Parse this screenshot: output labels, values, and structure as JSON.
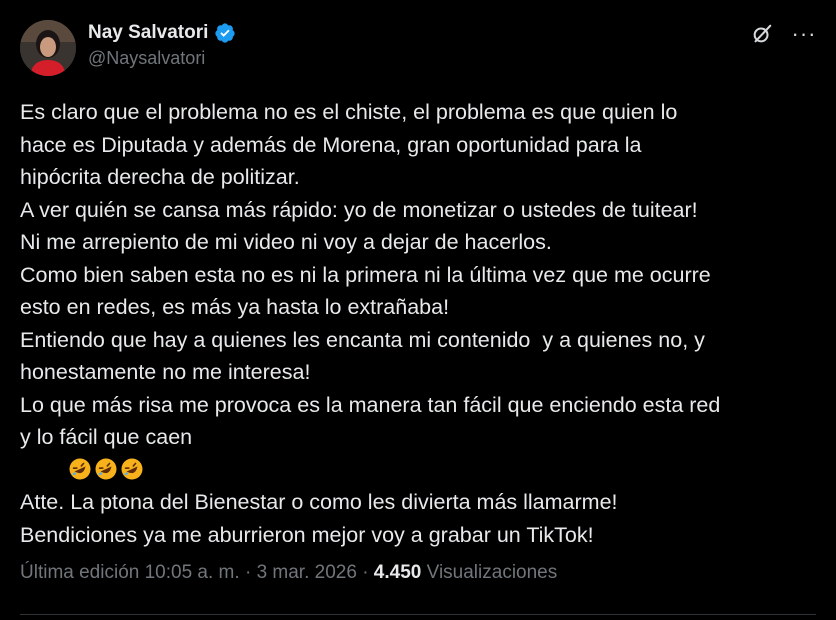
{
  "author": {
    "name": "Nay Salvatori",
    "handle": "@Naysalvatori",
    "verified": true
  },
  "tweet": {
    "lines": [
      "Es claro que el problema no es el chiste, el problema es que quien lo",
      "hace es Diputada y además de Morena, gran oportunidad para la",
      "hipócrita derecha de politizar.",
      "A ver quién se cansa más rápido: yo de monetizar o ustedes de tuitear!",
      "Ni me arrepiento de mi video ni voy a dejar de hacerlos.",
      "Como bien saben esta no es ni la primera ni la última vez que me ocurre",
      "esto en redes, es más ya hasta lo extrañaba!",
      "Entiendo que hay a quienes les encanta mi contenido  y a quienes no, y",
      "honestamente no me interesa!",
      "Lo que más risa me provoca es la manera tan fácil que enciendo esta red",
      "y lo fácil que caen ",
      "Atte. La ptona del Bienestar o como les divierta más llamarme!",
      "Bendiciones ya me aburrieron mejor voy a grabar un TikTok!"
    ],
    "emoji": [
      "rolling-on-the-floor-laughing",
      "rolling-on-the-floor-laughing",
      "rolling-on-the-floor-laughing"
    ]
  },
  "meta": {
    "edited": "Última edición 10:05 a. m.",
    "separator": "·",
    "date": "3 mar. 2026",
    "views_count": "4.450",
    "views_label": "Visualizaciones"
  },
  "icons": {
    "grok": "grok-icon",
    "more": "more-icon",
    "verified": "verified-badge-icon"
  },
  "colors": {
    "background": "#000000",
    "text": "#e7e9ea",
    "secondary": "#71767b",
    "verified": "#1d9bf0"
  }
}
